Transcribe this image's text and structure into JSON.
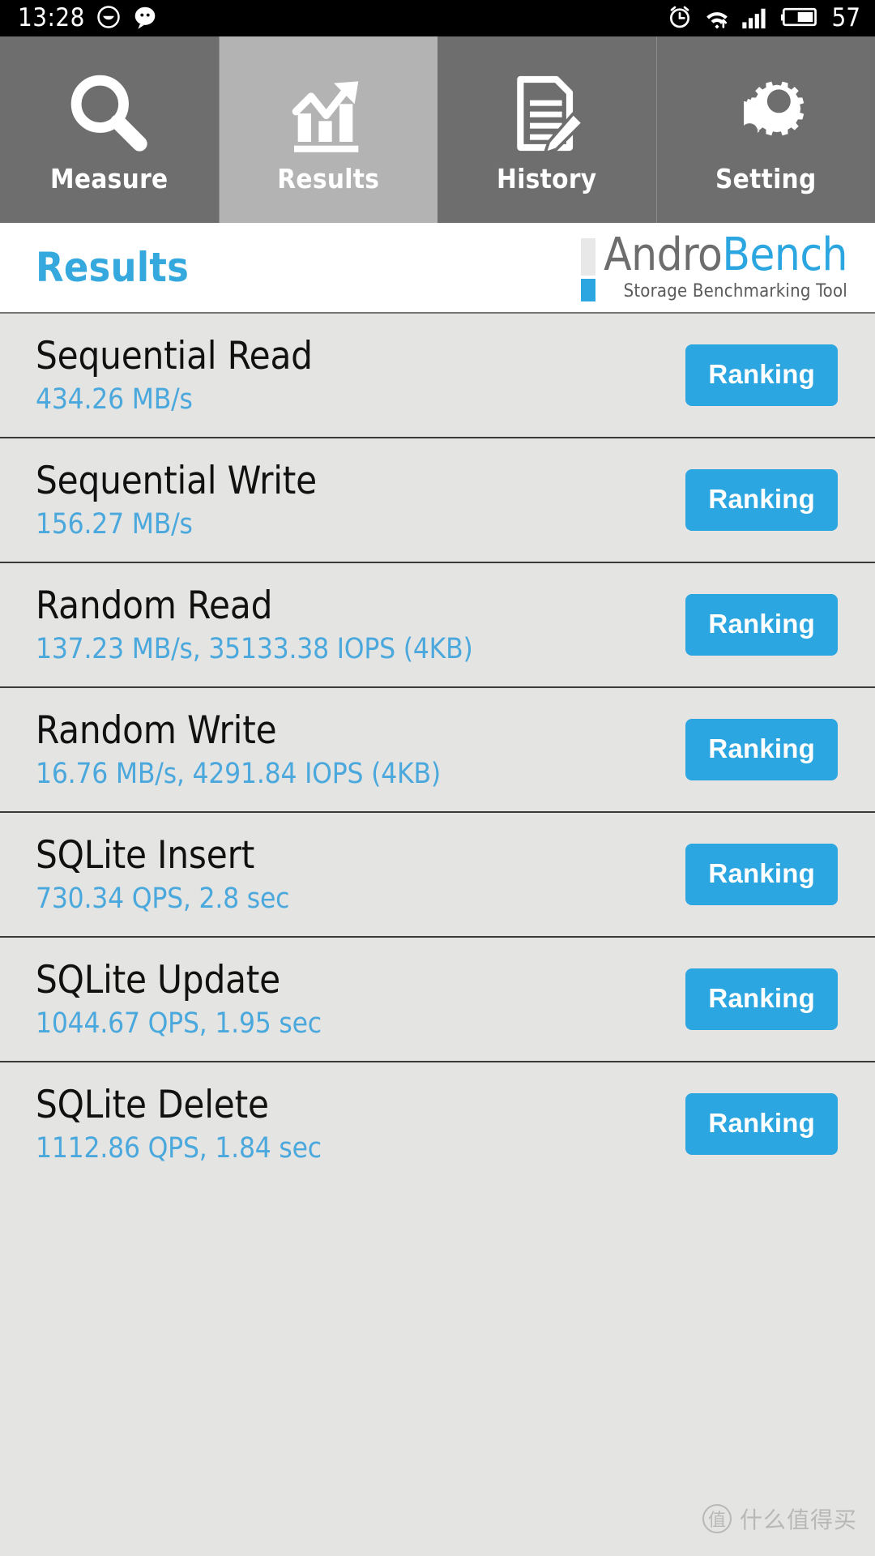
{
  "status_bar": {
    "time": "13:28",
    "battery_percent": "57",
    "icons_left": [
      "face-icon",
      "chat-bubble-icon"
    ],
    "icons_right": [
      "alarm-icon",
      "wifi-icon",
      "signal-bars-icon",
      "battery-icon"
    ]
  },
  "tabs": [
    {
      "label": "Measure",
      "icon": "magnifier-icon",
      "active": false
    },
    {
      "label": "Results",
      "icon": "bar-chart-icon",
      "active": true
    },
    {
      "label": "History",
      "icon": "document-pencil-icon",
      "active": false
    },
    {
      "label": "Setting",
      "icon": "gears-icon",
      "active": false
    }
  ],
  "header": {
    "page_title": "Results",
    "logo": {
      "word_primary": "Andro",
      "word_secondary": "Bench",
      "tagline": "Storage Benchmarking Tool"
    }
  },
  "results": [
    {
      "title": "Sequential Read",
      "value": "434.26 MB/s",
      "button": "Ranking"
    },
    {
      "title": "Sequential Write",
      "value": "156.27 MB/s",
      "button": "Ranking"
    },
    {
      "title": "Random Read",
      "value": "137.23 MB/s, 35133.38 IOPS (4KB)",
      "button": "Ranking"
    },
    {
      "title": "Random Write",
      "value": "16.76 MB/s, 4291.84 IOPS (4KB)",
      "button": "Ranking"
    },
    {
      "title": "SQLite Insert",
      "value": "730.34 QPS, 2.8 sec",
      "button": "Ranking"
    },
    {
      "title": "SQLite Update",
      "value": "1044.67 QPS, 1.95 sec",
      "button": "Ranking"
    },
    {
      "title": "SQLite Delete",
      "value": "1112.86 QPS, 1.84 sec",
      "button": "Ranking"
    }
  ],
  "watermark": {
    "badge": "值",
    "text": "什么值得买"
  },
  "colors": {
    "accent_blue": "#2ca6e0",
    "value_blue": "#4aa8dd",
    "tab_inactive": "#6e6e6e",
    "tab_active": "#b3b3b3",
    "list_background": "#e4e4e2"
  }
}
